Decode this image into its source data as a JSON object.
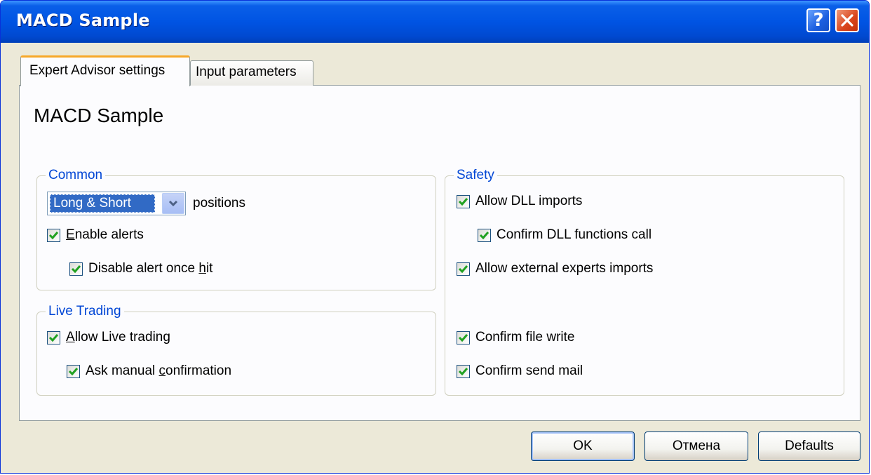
{
  "window": {
    "title": "MACD Sample"
  },
  "tabs": [
    {
      "label": "Expert Advisor settings",
      "active": true
    },
    {
      "label": "Input parameters",
      "active": false
    }
  ],
  "heading": "MACD Sample",
  "common": {
    "legend": "Common",
    "positions_select": {
      "value": "Long & Short"
    },
    "positions_label": "positions",
    "enable_alerts": {
      "pre": "",
      "key": "E",
      "post": "nable alerts",
      "checked": true
    },
    "disable_alert_once_hit": {
      "pre": "Disable alert once ",
      "key": "h",
      "post": "it",
      "checked": true
    }
  },
  "live_trading": {
    "legend": "Live Trading",
    "allow_live_trading": {
      "pre": "",
      "key": "A",
      "post": "llow Live trading",
      "checked": true
    },
    "ask_manual_confirmation": {
      "pre": "Ask manual ",
      "key": "c",
      "post": "onfirmation",
      "checked": true
    }
  },
  "safety": {
    "legend": "Safety",
    "allow_dll_imports": {
      "label": "Allow DLL imports",
      "checked": true
    },
    "confirm_dll_functions_call": {
      "label": "Confirm DLL functions call",
      "checked": true
    },
    "allow_external_experts_imports": {
      "label": "Allow external experts imports",
      "checked": true
    },
    "confirm_file_write": {
      "label": "Confirm file write",
      "checked": true
    },
    "confirm_send_mail": {
      "label": "Confirm send mail",
      "checked": true
    }
  },
  "buttons": {
    "ok": "OK",
    "cancel": "Отмена",
    "defaults": "Defaults"
  },
  "colors": {
    "title_bar": "#0054e3",
    "legend_text": "#0046d5",
    "check_mark": "#21a121",
    "tab_highlight": "#f7a829"
  },
  "icons": {
    "help": "question-mark",
    "close": "x-cross",
    "dropdown": "chevron-down",
    "checkbox_mark": "check-mark"
  }
}
